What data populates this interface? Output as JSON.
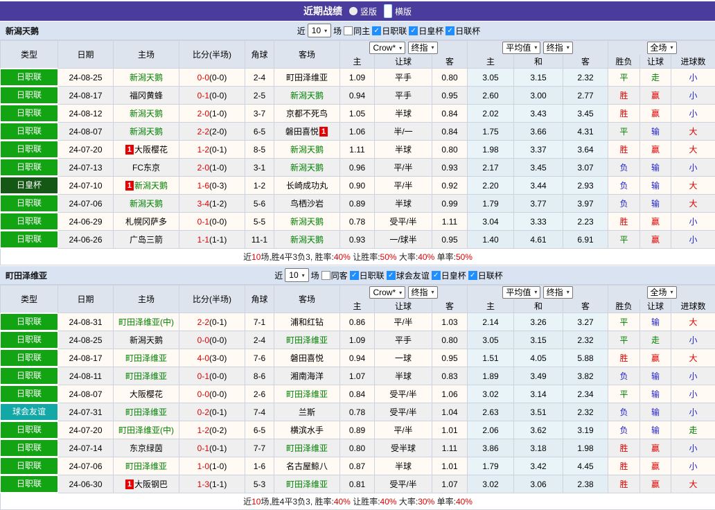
{
  "titlebar": {
    "title": "近期战绩",
    "radios": [
      {
        "label": "竖版",
        "selected": false
      },
      {
        "label": "横版",
        "selected": true
      }
    ]
  },
  "cols": {
    "type": "类型",
    "date": "日期",
    "home": "主场",
    "score": "比分(半场)",
    "corner": "角球",
    "away": "客场",
    "asia_home": "主",
    "asia_line": "让球",
    "asia_away": "客",
    "eu_home": "主",
    "eu_draw": "和",
    "eu_away": "客",
    "result": "胜负",
    "line_result": "让球",
    "goals": "进球数"
  },
  "selects": {
    "crow": "Crow*",
    "final1": "终指",
    "avg": "平均值",
    "final2": "终指",
    "full": "全场"
  },
  "filter_labels": {
    "near": "近",
    "games": "场"
  },
  "result_colors": {
    "胜": "c-red",
    "平": "c-green",
    "负": "c-blue",
    "赢": "c-red",
    "输": "c-blue",
    "走": "c-green",
    "大": "c-red",
    "小": "c-blue"
  },
  "sections": [
    {
      "team": "新潟天鹅",
      "filter": {
        "count": "10",
        "same": {
          "label": "同主",
          "checked": false
        },
        "leagues": [
          {
            "label": "日职联",
            "checked": true
          },
          {
            "label": "日皇杯",
            "checked": true
          },
          {
            "label": "日联杯",
            "checked": true
          }
        ]
      },
      "rows": [
        {
          "type": "日职联",
          "tc": "g",
          "date": "24-08-25",
          "home": {
            "n": "新潟天鹅",
            "g": true
          },
          "ft": "0-0",
          "ht": "(0-0)",
          "ck": "2-4",
          "away": {
            "n": "町田泽维亚"
          },
          "o": [
            "1.09",
            "平手",
            "0.80",
            "3.05",
            "3.15",
            "2.32"
          ],
          "r": [
            "平",
            "走",
            "小"
          ]
        },
        {
          "type": "日职联",
          "tc": "g",
          "date": "24-08-17",
          "home": {
            "n": "福冈黄蜂"
          },
          "ft": "0-1",
          "ht": "(0-0)",
          "ck": "2-5",
          "away": {
            "n": "新潟天鹅",
            "g": true
          },
          "o": [
            "0.94",
            "平手",
            "0.95",
            "2.60",
            "3.00",
            "2.77"
          ],
          "r": [
            "胜",
            "赢",
            "小"
          ]
        },
        {
          "type": "日职联",
          "tc": "g",
          "date": "24-08-12",
          "home": {
            "n": "新潟天鹅",
            "g": true
          },
          "ft": "2-0",
          "ht": "(1-0)",
          "ck": "3-7",
          "away": {
            "n": "京都不死鸟"
          },
          "o": [
            "1.05",
            "半球",
            "0.84",
            "2.02",
            "3.43",
            "3.45"
          ],
          "r": [
            "胜",
            "赢",
            "小"
          ]
        },
        {
          "type": "日职联",
          "tc": "g",
          "date": "24-08-07",
          "home": {
            "n": "新潟天鹅",
            "g": true
          },
          "ft": "2-2",
          "ht": "(2-0)",
          "ck": "6-5",
          "away": {
            "n": "磐田喜悦",
            "b": "post"
          },
          "o": [
            "1.06",
            "半/一",
            "0.84",
            "1.75",
            "3.66",
            "4.31"
          ],
          "r": [
            "平",
            "输",
            "大"
          ]
        },
        {
          "type": "日职联",
          "tc": "g",
          "date": "24-07-20",
          "home": {
            "n": "大阪樱花",
            "b": "pre"
          },
          "ft": "1-2",
          "ht": "(0-1)",
          "ck": "8-5",
          "away": {
            "n": "新潟天鹅",
            "g": true
          },
          "o": [
            "1.11",
            "半球",
            "0.80",
            "1.98",
            "3.37",
            "3.64"
          ],
          "r": [
            "胜",
            "赢",
            "大"
          ]
        },
        {
          "type": "日职联",
          "tc": "g",
          "date": "24-07-13",
          "home": {
            "n": "FC东京"
          },
          "ft": "2-0",
          "ht": "(1-0)",
          "ck": "3-1",
          "away": {
            "n": "新潟天鹅",
            "g": true
          },
          "o": [
            "0.96",
            "平/半",
            "0.93",
            "2.17",
            "3.45",
            "3.07"
          ],
          "r": [
            "负",
            "输",
            "小"
          ]
        },
        {
          "type": "日皇杯",
          "tc": "dg",
          "date": "24-07-10",
          "home": {
            "n": "新潟天鹅",
            "g": true,
            "b": "pre"
          },
          "ft": "1-6",
          "ht": "(0-3)",
          "ck": "1-2",
          "away": {
            "n": "长崎成功丸"
          },
          "o": [
            "0.90",
            "平/半",
            "0.92",
            "2.20",
            "3.44",
            "2.93"
          ],
          "r": [
            "负",
            "输",
            "大"
          ]
        },
        {
          "type": "日职联",
          "tc": "g",
          "date": "24-07-06",
          "home": {
            "n": "新潟天鹅",
            "g": true
          },
          "ft": "3-4",
          "ht": "(1-2)",
          "ck": "5-6",
          "away": {
            "n": "鸟栖沙岩"
          },
          "o": [
            "0.89",
            "半球",
            "0.99",
            "1.79",
            "3.77",
            "3.97"
          ],
          "r": [
            "负",
            "输",
            "大"
          ]
        },
        {
          "type": "日职联",
          "tc": "g",
          "date": "24-06-29",
          "home": {
            "n": "札幌冈萨多"
          },
          "ft": "0-1",
          "ht": "(0-0)",
          "ck": "5-5",
          "away": {
            "n": "新潟天鹅",
            "g": true
          },
          "o": [
            "0.78",
            "受平/半",
            "1.11",
            "3.04",
            "3.33",
            "2.23"
          ],
          "r": [
            "胜",
            "赢",
            "小"
          ]
        },
        {
          "type": "日职联",
          "tc": "g",
          "date": "24-06-26",
          "home": {
            "n": "广岛三箭"
          },
          "ft": "1-1",
          "ht": "(1-1)",
          "ck": "11-1",
          "away": {
            "n": "新潟天鹅",
            "g": true
          },
          "o": [
            "0.93",
            "一/球半",
            "0.95",
            "1.40",
            "4.61",
            "6.91"
          ],
          "r": [
            "平",
            "赢",
            "小"
          ]
        }
      ],
      "summary": [
        {
          "t": "近"
        },
        {
          "t": "10",
          "r": true
        },
        {
          "t": "场,胜4平3负3, 胜率:"
        },
        {
          "t": "40%",
          "r": true
        },
        {
          "t": " 让胜率:"
        },
        {
          "t": "50%",
          "r": true
        },
        {
          "t": " 大率:"
        },
        {
          "t": "40%",
          "r": true
        },
        {
          "t": " 单率:"
        },
        {
          "t": "50%",
          "r": true
        }
      ]
    },
    {
      "team": "町田泽维亚",
      "filter": {
        "count": "10",
        "same": {
          "label": "同客",
          "checked": false
        },
        "leagues": [
          {
            "label": "日职联",
            "checked": true
          },
          {
            "label": "球会友谊",
            "checked": true
          },
          {
            "label": "日皇杯",
            "checked": true
          },
          {
            "label": "日联杯",
            "checked": true
          }
        ]
      },
      "rows": [
        {
          "type": "日职联",
          "tc": "g",
          "date": "24-08-31",
          "home": {
            "n": "町田泽维亚(中)",
            "g": true
          },
          "ft": "2-2",
          "ht": "(0-1)",
          "ck": "7-1",
          "away": {
            "n": "浦和红钻"
          },
          "o": [
            "0.86",
            "平/半",
            "1.03",
            "2.14",
            "3.26",
            "3.27"
          ],
          "r": [
            "平",
            "输",
            "大"
          ]
        },
        {
          "type": "日职联",
          "tc": "g",
          "date": "24-08-25",
          "home": {
            "n": "新潟天鹅"
          },
          "ft": "0-0",
          "ht": "(0-0)",
          "ck": "2-4",
          "away": {
            "n": "町田泽维亚",
            "g": true
          },
          "o": [
            "1.09",
            "平手",
            "0.80",
            "3.05",
            "3.15",
            "2.32"
          ],
          "r": [
            "平",
            "走",
            "小"
          ]
        },
        {
          "type": "日职联",
          "tc": "g",
          "date": "24-08-17",
          "home": {
            "n": "町田泽维亚",
            "g": true
          },
          "ft": "4-0",
          "ht": "(3-0)",
          "ck": "7-6",
          "away": {
            "n": "磐田喜悦"
          },
          "o": [
            "0.94",
            "一球",
            "0.95",
            "1.51",
            "4.05",
            "5.88"
          ],
          "r": [
            "胜",
            "赢",
            "大"
          ]
        },
        {
          "type": "日职联",
          "tc": "g",
          "date": "24-08-11",
          "home": {
            "n": "町田泽维亚",
            "g": true
          },
          "ft": "0-1",
          "ht": "(0-0)",
          "ck": "8-6",
          "away": {
            "n": "湘南海洋"
          },
          "o": [
            "1.07",
            "半球",
            "0.83",
            "1.89",
            "3.49",
            "3.82"
          ],
          "r": [
            "负",
            "输",
            "小"
          ]
        },
        {
          "type": "日职联",
          "tc": "g",
          "date": "24-08-07",
          "home": {
            "n": "大阪樱花"
          },
          "ft": "0-0",
          "ht": "(0-0)",
          "ck": "2-6",
          "away": {
            "n": "町田泽维亚",
            "g": true
          },
          "o": [
            "0.84",
            "受平/半",
            "1.06",
            "3.02",
            "3.14",
            "2.34"
          ],
          "r": [
            "平",
            "输",
            "小"
          ]
        },
        {
          "type": "球会友谊",
          "tc": "tl",
          "date": "24-07-31",
          "home": {
            "n": "町田泽维亚",
            "g": true
          },
          "ft": "0-2",
          "ht": "(0-1)",
          "ck": "7-4",
          "away": {
            "n": "兰斯"
          },
          "o": [
            "0.78",
            "受平/半",
            "1.04",
            "2.63",
            "3.51",
            "2.32"
          ],
          "r": [
            "负",
            "输",
            "小"
          ]
        },
        {
          "type": "日职联",
          "tc": "g",
          "date": "24-07-20",
          "home": {
            "n": "町田泽维亚(中)",
            "g": true
          },
          "ft": "1-2",
          "ht": "(0-2)",
          "ck": "6-5",
          "away": {
            "n": "横滨水手"
          },
          "o": [
            "0.89",
            "平/半",
            "1.01",
            "2.06",
            "3.62",
            "3.19"
          ],
          "r": [
            "负",
            "输",
            "走"
          ]
        },
        {
          "type": "日职联",
          "tc": "g",
          "date": "24-07-14",
          "home": {
            "n": "东京绿茵"
          },
          "ft": "0-1",
          "ht": "(0-1)",
          "ck": "7-7",
          "away": {
            "n": "町田泽维亚",
            "g": true
          },
          "o": [
            "0.80",
            "受半球",
            "1.11",
            "3.86",
            "3.18",
            "1.98"
          ],
          "r": [
            "胜",
            "赢",
            "小"
          ]
        },
        {
          "type": "日职联",
          "tc": "g",
          "date": "24-07-06",
          "home": {
            "n": "町田泽维亚",
            "g": true
          },
          "ft": "1-0",
          "ht": "(1-0)",
          "ck": "1-6",
          "away": {
            "n": "名古屋鲸八"
          },
          "o": [
            "0.87",
            "半球",
            "1.01",
            "1.79",
            "3.42",
            "4.45"
          ],
          "r": [
            "胜",
            "赢",
            "小"
          ]
        },
        {
          "type": "日职联",
          "tc": "g",
          "date": "24-06-30",
          "home": {
            "n": "大阪钢巴",
            "b": "pre"
          },
          "ft": "1-3",
          "ht": "(1-1)",
          "ck": "5-3",
          "away": {
            "n": "町田泽维亚",
            "g": true
          },
          "o": [
            "0.81",
            "受平/半",
            "1.07",
            "3.02",
            "3.06",
            "2.38"
          ],
          "r": [
            "胜",
            "赢",
            "大"
          ]
        }
      ],
      "summary": [
        {
          "t": "近"
        },
        {
          "t": "10",
          "r": true
        },
        {
          "t": "场,胜4平3负3, 胜率:"
        },
        {
          "t": "40%",
          "r": true
        },
        {
          "t": " 让胜率:"
        },
        {
          "t": "40%",
          "r": true
        },
        {
          "t": " 大率:"
        },
        {
          "t": "30%",
          "r": true
        },
        {
          "t": " 单率:"
        },
        {
          "t": "40%",
          "r": true
        }
      ]
    }
  ]
}
